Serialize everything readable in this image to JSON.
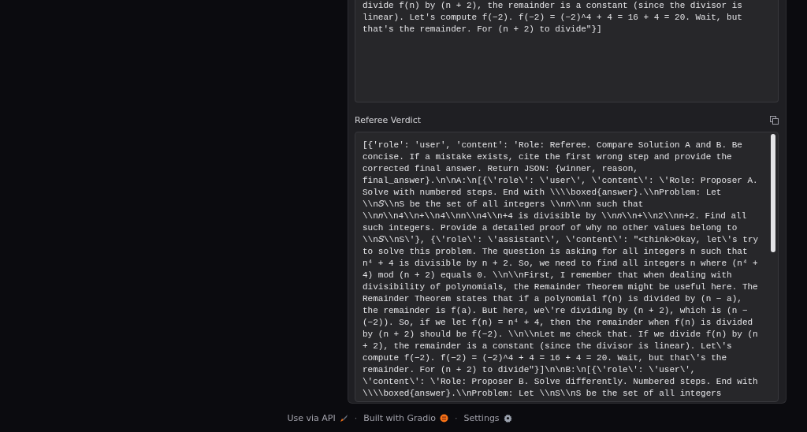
{
  "previous_output": {
    "lines": [
      "divide f(n) by (n + 2), the remainder is a constant (since the divisor is",
      "linear). Let's compute f(−2). f(−2) = (−2)^4 + 4 = 16 + 4 = 20. Wait, but",
      "that's the remainder. For (n + 2) to divide\"}]"
    ]
  },
  "referee_verdict": {
    "label": "Referee Verdict",
    "lines": [
      "[{'role': 'user', 'content': 'Role: Referee. Compare Solution A and B. Be",
      "concise. If a mistake exists, cite the first wrong step and provide the",
      "corrected final answer. Return JSON: {winner, reason,",
      "final_answer}.\\n\\nA:\\n[{\\'role\\': \\'user\\', \\'content\\': \\'Role: Proposer A.",
      "Solve with numbered steps. End with \\\\\\\\boxed{answer}.\\\\nProblem: Let",
      "\\\\n𝑆\\\\nS be the set of all integers \\\\n𝑛\\\\nn such that",
      "\\\\n𝑛\\\\n4\\\\n+\\\\n4\\\\nn\\\\n4\\\\n+4 is divisible by \\\\n𝑛\\\\n+\\\\n2\\\\nn+2. Find all",
      "such integers. Provide a detailed proof of why no other values belong to",
      "\\\\n𝑆\\\\nS\\'}, {\\'role\\': \\'assistant\\', \\'content\\': \"<think>Okay, let\\'s try",
      "to solve this problem. The question is asking for all integers n such that",
      "n⁴ + 4 is divisible by n + 2. So, we need to find all integers n where (n⁴ +",
      "4) mod (n + 2) equals 0. \\\\n\\\\nFirst, I remember that when dealing with",
      "divisibility of polynomials, the Remainder Theorem might be useful here. The",
      "Remainder Theorem states that if a polynomial f(n) is divided by (n − a),",
      "the remainder is f(a). But here, we\\'re dividing by (n + 2), which is (n −",
      "(−2)). So, if we let f(n) = n⁴ + 4, then the remainder when f(n) is divided",
      "by (n + 2) should be f(−2). \\\\n\\\\nLet me check that. If we divide f(n) by (n",
      "+ 2), the remainder is a constant (since the divisor is linear). Let\\'s",
      "compute f(−2). f(−2) = (−2)^4 + 4 = 16 + 4 = 20. Wait, but that\\'s the",
      "remainder. For (n + 2) to divide\"}]\\n\\nB:\\n[{\\'role\\': \\'user\\',",
      "\\'content\\': \\'Role: Proposer B. Solve differently. Numbered steps. End with",
      "\\\\\\\\boxed{answer}.\\\\nProblem: Let \\\\nS\\\\nS be the set of all integers"
    ]
  },
  "footer": {
    "links": [
      {
        "kind": "api",
        "label": "Use via API"
      },
      {
        "kind": "gradio",
        "label": "Built with Gradio"
      },
      {
        "kind": "settings",
        "label": "Settings"
      }
    ],
    "separator": "·"
  }
}
